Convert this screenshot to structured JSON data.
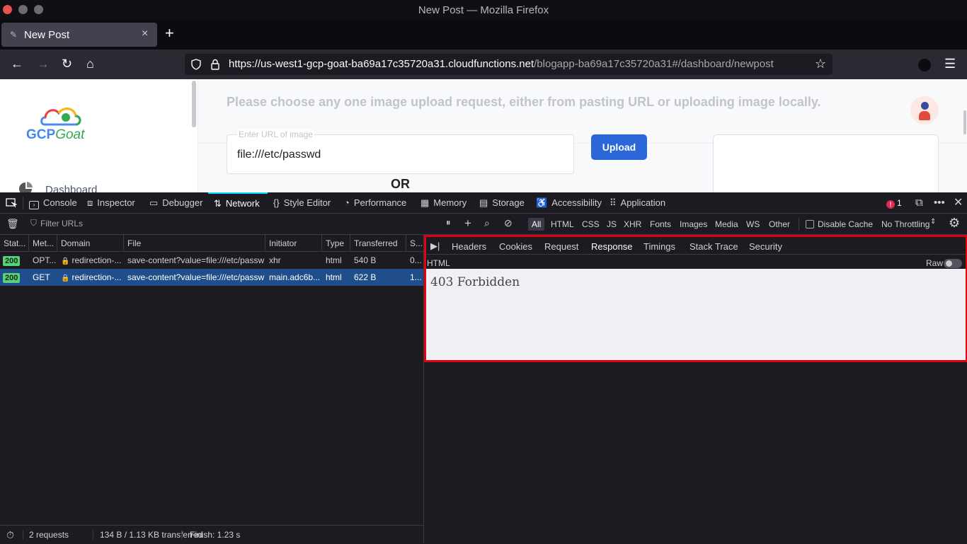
{
  "window": {
    "title": "New Post — Mozilla Firefox"
  },
  "tab": {
    "title": "New Post",
    "close": "×",
    "new_tab": "+"
  },
  "navbar": {
    "url_host": "https://us-west1-gcp-goat-ba69a17c35720a31.cloudfunctions.net",
    "url_path": "/blogapp-ba69a17c35720a31#/dashboard/newpost"
  },
  "page": {
    "logo": {
      "gcp": "GCP",
      "goat": "Goat"
    },
    "heading": "Please choose any one image upload request, either from pasting URL or uploading image locally.",
    "url_field_label": "Enter URL of image",
    "url_field_value": "file:///etc/passwd",
    "upload_button": "Upload",
    "or_label": "OR",
    "sidebar_item": "Dashboard"
  },
  "devtools": {
    "tabs": [
      "Console",
      "Inspector",
      "Debugger",
      "Network",
      "Style Editor",
      "Performance",
      "Memory",
      "Storage",
      "Accessibility",
      "Application"
    ],
    "active_tab": "Network",
    "error_count": "1",
    "filter_placeholder": "Filter URLs",
    "filter_types": [
      "All",
      "HTML",
      "CSS",
      "JS",
      "XHR",
      "Fonts",
      "Images",
      "Media",
      "WS",
      "Other"
    ],
    "disable_cache": "Disable Cache",
    "throttling": "No Throttling",
    "columns": [
      "Stat...",
      "Met...",
      "Domain",
      "File",
      "Initiator",
      "Type",
      "Transferred",
      "S..."
    ],
    "requests": [
      {
        "status": "200",
        "method": "OPT...",
        "domain": "redirection-...",
        "file": "save-content?value=file:///etc/passwd",
        "initiator": "xhr",
        "type": "html",
        "transferred": "540 B",
        "size": "0..."
      },
      {
        "status": "200",
        "method": "GET",
        "domain": "redirection-...",
        "file": "save-content?value=file:///etc/passwd",
        "initiator": "main.adc6b...",
        "type": "html",
        "transferred": "622 B",
        "size": "1..."
      }
    ],
    "detail_tabs": [
      "Headers",
      "Cookies",
      "Request",
      "Response",
      "Timings",
      "Stack Trace",
      "Security"
    ],
    "active_detail_tab": "Response",
    "response_format": "HTML",
    "raw_label": "Raw",
    "response_body": "403 Forbidden",
    "status": {
      "requests": "2 requests",
      "transferred": "134 B / 1.13 KB transferred",
      "finish": "Finish: 1.23 s"
    }
  }
}
